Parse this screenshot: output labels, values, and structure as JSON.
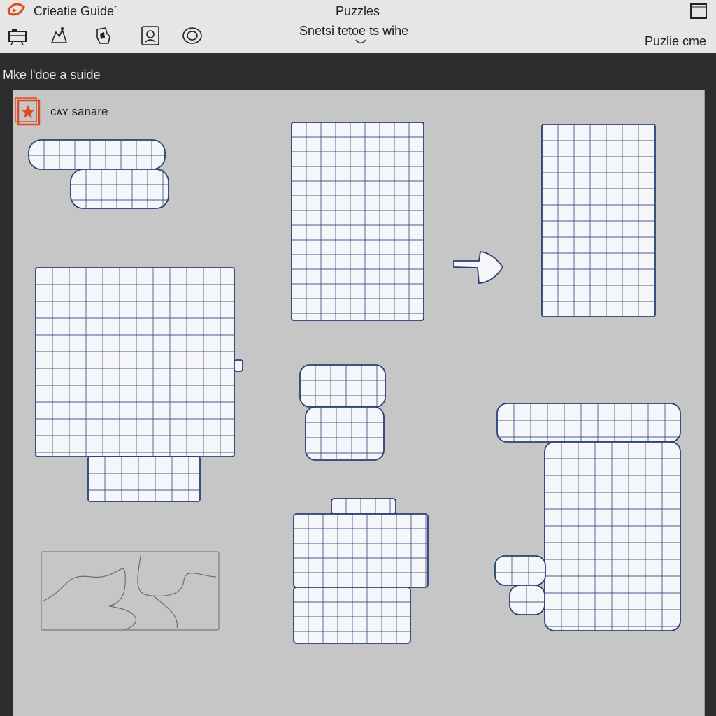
{
  "header": {
    "app_title": "Crieatie Guide´",
    "center_title": "Puzzles",
    "center_subtitle": "Snetsi tetoe ts wihe",
    "right_label": "Puzlie cme",
    "tools": [
      {
        "icon": "camera-icon"
      },
      {
        "icon": "puzzle-figure-icon"
      },
      {
        "icon": "hand-piece-icon"
      },
      {
        "icon": "document-face-icon"
      },
      {
        "icon": "target-ring-icon"
      }
    ]
  },
  "hint": {
    "text": "Mke l'doe a suide"
  },
  "canvas": {
    "layer_label": "ᴄᴀʏ sanare",
    "pieces": [
      {
        "name": "puzzle-piece-small-top-left"
      },
      {
        "name": "puzzle-grid-top-center"
      },
      {
        "name": "puzzle-grid-top-right"
      },
      {
        "name": "puzzle-grid-large-left"
      },
      {
        "name": "puzzle-piece-center"
      },
      {
        "name": "puzzle-grid-bottom-center"
      },
      {
        "name": "puzzle-grid-bottom-right"
      }
    ],
    "outline_box": {
      "name": "puzzle-outline-preview"
    },
    "arrow": {
      "name": "right-arrow-icon"
    }
  },
  "colors": {
    "accent": "#e04a1f",
    "grid_line": "#2b3f73",
    "tile": "#f5f6fa",
    "canvas": "#c6c6c6",
    "toolbar": "#e6e6e6",
    "frame": "#2d2d30"
  }
}
